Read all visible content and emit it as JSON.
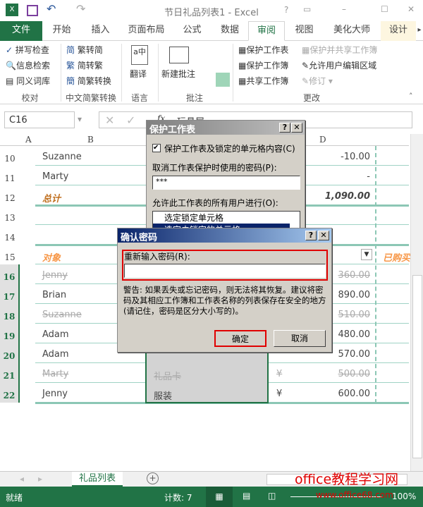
{
  "window": {
    "title": "节日礼品列表1 - Excel",
    "help": "?",
    "restore": "▭",
    "minimize": "–",
    "maximize": "☐",
    "close": "✕"
  },
  "tabs": [
    {
      "label": "文件"
    },
    {
      "label": "开始"
    },
    {
      "label": "插入"
    },
    {
      "label": "页面布局"
    },
    {
      "label": "公式"
    },
    {
      "label": "数据"
    },
    {
      "label": "审阅"
    },
    {
      "label": "视图"
    },
    {
      "label": "美化大师"
    },
    {
      "label": "设计"
    }
  ],
  "ribbon": {
    "proofing": {
      "label": "校对",
      "items": [
        "拼写检查",
        "信息检索",
        "同义词库"
      ]
    },
    "chinese": {
      "label": "中文简繁转换",
      "items": [
        "繁转简",
        "简转繁",
        "简繁转换"
      ]
    },
    "language": {
      "label": "语言",
      "items": [
        "翻译"
      ]
    },
    "comments": {
      "label": "批注",
      "items": [
        "新建批注"
      ]
    },
    "changes": {
      "label": "更改",
      "items": [
        "保护工作表",
        "保护工作簿",
        "共享工作簿",
        "保护并共享工作簿",
        "允许用户编辑区域",
        "修订"
      ]
    }
  },
  "formula_bar": {
    "name_box": "C16",
    "fx": "fx",
    "value": "玩具屋"
  },
  "columns": [
    "A",
    "B",
    "D"
  ],
  "rows": [
    {
      "num": "10",
      "name": "Suzanne",
      "amount": "-10.00"
    },
    {
      "num": "11",
      "name": "Marty",
      "amount": "-"
    },
    {
      "num": "12",
      "name": "总计",
      "amount": "1,090.00"
    },
    {
      "num": "13"
    },
    {
      "num": "14"
    },
    {
      "num": "15",
      "name": "对象",
      "extra": "已购买"
    },
    {
      "num": "16",
      "name": "Jenny",
      "amount": "360.00",
      "strike": true
    },
    {
      "num": "17",
      "name": "Brian",
      "amount": "890.00"
    },
    {
      "num": "18",
      "name": "Suzanne",
      "amount": "510.00",
      "strike": true
    },
    {
      "num": "19",
      "name": "Adam",
      "amount": "480.00"
    },
    {
      "num": "20",
      "name": "Adam",
      "amount": "570.00"
    },
    {
      "num": "21",
      "name": "Marty",
      "item": "礼品卡",
      "currency": "¥",
      "amount": "500.00",
      "strike": true
    },
    {
      "num": "22",
      "name": "Jenny",
      "item": "服装",
      "currency": "¥",
      "amount": "600.00"
    }
  ],
  "protect_dialog": {
    "title": "保护工作表",
    "checkbox": "保护工作表及锁定的单元格内容(C)",
    "checked": true,
    "password_label": "取消工作表保护时使用的密码(P):",
    "password_value": "***",
    "allow_label": "允许此工作表的所有用户进行(O):",
    "options": [
      "选定锁定单元格",
      "选定未锁定的单元格"
    ]
  },
  "confirm_dialog": {
    "title": "确认密码",
    "label": "重新输入密码(R):",
    "value": "",
    "warning": "警告: 如果丢失或忘记密码，则无法将其恢复。建议将密码及其相应工作簿和工作表名称的列表保存在安全的地方(请记住，密码是区分大小写的)。",
    "ok": "确定",
    "cancel": "取消"
  },
  "sheet_tabs": {
    "active": "礼品列表",
    "add": "+"
  },
  "watermark": "office教程学习网",
  "watermark_url": "www.office68.com",
  "status": {
    "ready": "就绪",
    "count": "计数: 7",
    "zoom": "100%"
  },
  "colors": {
    "excel_green": "#217346",
    "dialog_title": "#0a246a",
    "highlight_red": "#e00000"
  }
}
